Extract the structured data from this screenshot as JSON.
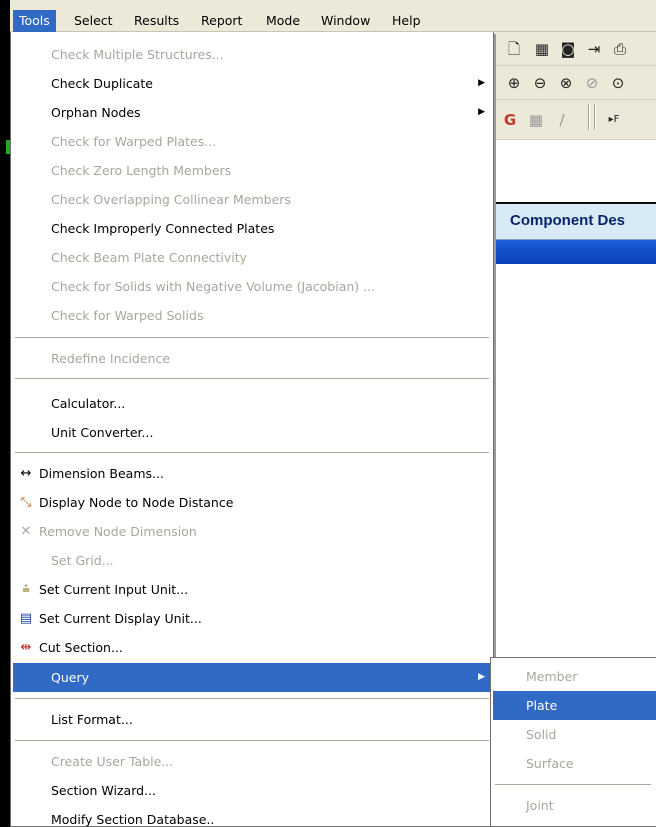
{
  "menubar": {
    "items": [
      {
        "label": "Tools",
        "active": true
      },
      {
        "label": "Select"
      },
      {
        "label": "Results"
      },
      {
        "label": "Report"
      },
      {
        "label": "Mode"
      },
      {
        "label": "Window"
      },
      {
        "label": "Help"
      }
    ]
  },
  "app": {
    "component_header": "Component Des"
  },
  "tools_menu": {
    "items": [
      {
        "label": "Check Multiple Structures...",
        "enabled": false
      },
      {
        "label": "Check Duplicate",
        "enabled": true,
        "submenu": true
      },
      {
        "label": "Orphan Nodes",
        "enabled": true,
        "submenu": true
      },
      {
        "label": "Check for Warped Plates...",
        "enabled": false
      },
      {
        "label": "Check Zero Length Members",
        "enabled": false
      },
      {
        "label": "Check Overlapping Collinear Members",
        "enabled": false
      },
      {
        "label": "Check Improperly Connected Plates",
        "enabled": true
      },
      {
        "label": "Check Beam Plate Connectivity",
        "enabled": false
      },
      {
        "label": "Check for Solids with Negative Volume (Jacobian) ...",
        "enabled": false
      },
      {
        "label": "Check for Warped Solids",
        "enabled": false
      },
      {
        "label": "Redefine Incidence",
        "enabled": false
      },
      {
        "label": "Calculator...",
        "enabled": true
      },
      {
        "label": "Unit Converter...",
        "enabled": true
      },
      {
        "label": "Dimension Beams...",
        "enabled": true,
        "icon": "dimension-beams-icon"
      },
      {
        "label": "Display Node to Node Distance",
        "enabled": true,
        "icon": "node-distance-icon"
      },
      {
        "label": "Remove Node Dimension",
        "enabled": false,
        "icon": "remove-node-dimension-icon"
      },
      {
        "label": "Set Grid...",
        "enabled": false
      },
      {
        "label": "Set Current Input Unit...",
        "enabled": true,
        "icon": "input-unit-icon"
      },
      {
        "label": "Set Current Display Unit...",
        "enabled": true,
        "icon": "display-unit-icon"
      },
      {
        "label": "Cut Section...",
        "enabled": true,
        "icon": "cut-section-icon"
      },
      {
        "label": "Query",
        "enabled": true,
        "submenu": true,
        "selected": true
      },
      {
        "label": "List Format...",
        "enabled": true
      },
      {
        "label": "Create User Table...",
        "enabled": false
      },
      {
        "label": "Section Wizard...",
        "enabled": true
      },
      {
        "label": "Modify Section Database..",
        "enabled": true
      }
    ]
  },
  "query_submenu": {
    "items": [
      {
        "label": "Member",
        "enabled": false
      },
      {
        "label": "Plate",
        "enabled": true,
        "selected": true
      },
      {
        "label": "Solid",
        "enabled": false
      },
      {
        "label": "Surface",
        "enabled": false
      },
      {
        "label": "Joint",
        "enabled": false
      }
    ]
  },
  "colors": {
    "menu_highlight": "#316ac5",
    "disabled_text": "#a7a79c",
    "menubar_bg": "#ece9d8"
  }
}
